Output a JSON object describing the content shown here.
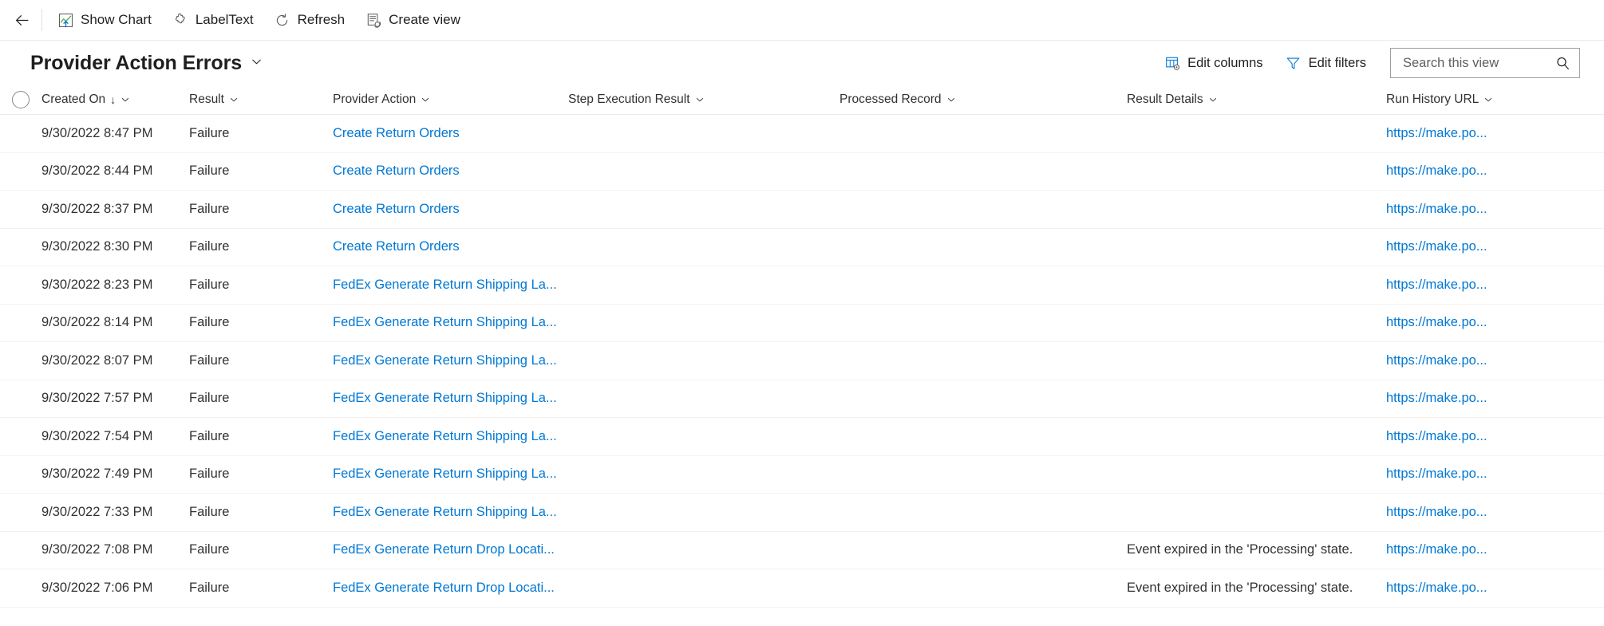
{
  "commandbar": {
    "back_label": "Back",
    "items": [
      {
        "label": "Show Chart",
        "icon": "show-chart-icon"
      },
      {
        "label": "LabelText",
        "icon": "plugin-icon"
      },
      {
        "label": "Refresh",
        "icon": "refresh-icon"
      },
      {
        "label": "Create view",
        "icon": "create-view-icon"
      }
    ]
  },
  "header": {
    "title": "Provider Action Errors",
    "edit_columns_label": "Edit columns",
    "edit_filters_label": "Edit filters",
    "search_placeholder": "Search this view",
    "search_value": ""
  },
  "grid": {
    "columns": [
      {
        "key": "created_on",
        "label": "Created On",
        "sort": "↓"
      },
      {
        "key": "result",
        "label": "Result",
        "sort": ""
      },
      {
        "key": "action",
        "label": "Provider Action",
        "sort": ""
      },
      {
        "key": "step",
        "label": "Step Execution Result",
        "sort": ""
      },
      {
        "key": "processed",
        "label": "Processed Record",
        "sort": ""
      },
      {
        "key": "details",
        "label": "Result Details",
        "sort": ""
      },
      {
        "key": "url",
        "label": "Run History URL",
        "sort": ""
      }
    ],
    "rows": [
      {
        "created_on": "9/30/2022 8:47 PM",
        "result": "Failure",
        "action": "Create Return Orders",
        "step": "",
        "processed": "",
        "details": "",
        "url": "https://make.po..."
      },
      {
        "created_on": "9/30/2022 8:44 PM",
        "result": "Failure",
        "action": "Create Return Orders",
        "step": "",
        "processed": "",
        "details": "",
        "url": "https://make.po..."
      },
      {
        "created_on": "9/30/2022 8:37 PM",
        "result": "Failure",
        "action": "Create Return Orders",
        "step": "",
        "processed": "",
        "details": "",
        "url": "https://make.po..."
      },
      {
        "created_on": "9/30/2022 8:30 PM",
        "result": "Failure",
        "action": "Create Return Orders",
        "step": "",
        "processed": "",
        "details": "",
        "url": "https://make.po..."
      },
      {
        "created_on": "9/30/2022 8:23 PM",
        "result": "Failure",
        "action": "FedEx Generate Return Shipping La...",
        "step": "",
        "processed": "",
        "details": "",
        "url": "https://make.po..."
      },
      {
        "created_on": "9/30/2022 8:14 PM",
        "result": "Failure",
        "action": "FedEx Generate Return Shipping La...",
        "step": "",
        "processed": "",
        "details": "",
        "url": "https://make.po..."
      },
      {
        "created_on": "9/30/2022 8:07 PM",
        "result": "Failure",
        "action": "FedEx Generate Return Shipping La...",
        "step": "",
        "processed": "",
        "details": "",
        "url": "https://make.po..."
      },
      {
        "created_on": "9/30/2022 7:57 PM",
        "result": "Failure",
        "action": "FedEx Generate Return Shipping La...",
        "step": "",
        "processed": "",
        "details": "",
        "url": "https://make.po..."
      },
      {
        "created_on": "9/30/2022 7:54 PM",
        "result": "Failure",
        "action": "FedEx Generate Return Shipping La...",
        "step": "",
        "processed": "",
        "details": "",
        "url": "https://make.po..."
      },
      {
        "created_on": "9/30/2022 7:49 PM",
        "result": "Failure",
        "action": "FedEx Generate Return Shipping La...",
        "step": "",
        "processed": "",
        "details": "",
        "url": "https://make.po..."
      },
      {
        "created_on": "9/30/2022 7:33 PM",
        "result": "Failure",
        "action": "FedEx Generate Return Shipping La...",
        "step": "",
        "processed": "",
        "details": "",
        "url": "https://make.po..."
      },
      {
        "created_on": "9/30/2022 7:08 PM",
        "result": "Failure",
        "action": "FedEx Generate Return Drop Locati...",
        "step": "",
        "processed": "",
        "details": "Event expired in the 'Processing' state.",
        "url": "https://make.po..."
      },
      {
        "created_on": "9/30/2022 7:06 PM",
        "result": "Failure",
        "action": "FedEx Generate Return Drop Locati...",
        "step": "",
        "processed": "",
        "details": "Event expired in the 'Processing' state.",
        "url": "https://make.po..."
      }
    ]
  },
  "colors": {
    "link": "#0078d4",
    "text": "#323130",
    "border": "#edebe9",
    "row_border": "#f3f2f1",
    "accent_green": "#5eb25e"
  }
}
